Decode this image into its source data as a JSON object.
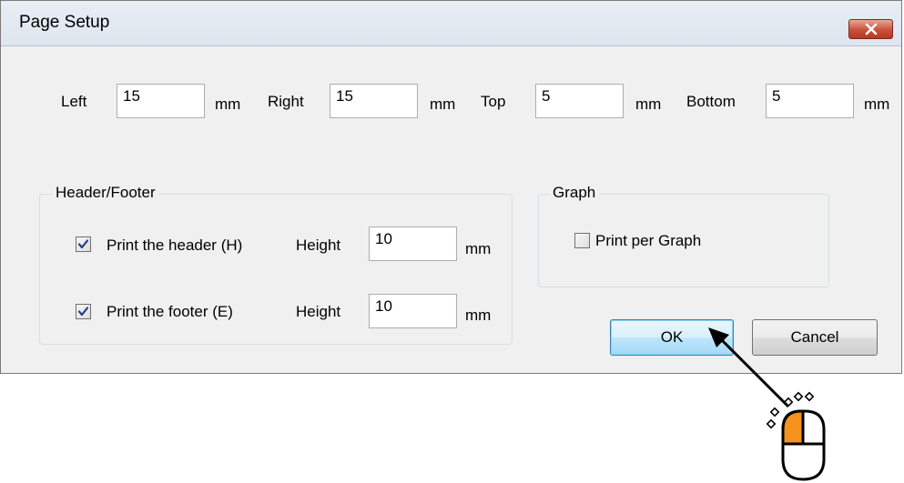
{
  "window": {
    "title": "Page Setup",
    "close_icon": "close-icon"
  },
  "margins": {
    "left_label": "Left",
    "left_value": "15",
    "right_label": "Right",
    "right_value": "15",
    "top_label": "Top",
    "top_value": "5",
    "bottom_label": "Bottom",
    "bottom_value": "5",
    "unit": "mm"
  },
  "header_footer": {
    "group_title": "Header/Footer",
    "header_checkbox_label": "Print the header (H)",
    "header_checked": true,
    "header_height_label": "Height",
    "header_height_value": "10",
    "footer_checkbox_label": "Print the footer (E)",
    "footer_checked": true,
    "footer_height_label": "Height",
    "footer_height_value": "10",
    "unit": "mm"
  },
  "graph": {
    "group_title": "Graph",
    "print_per_graph_label": "Print per Graph",
    "print_per_graph_checked": false
  },
  "buttons": {
    "ok_label": "OK",
    "cancel_label": "Cancel"
  },
  "annotation": {
    "pointer_icon": "arrow-icon",
    "mouse_icon": "mouse-left-click-icon",
    "accent_color": "#f5921e"
  }
}
